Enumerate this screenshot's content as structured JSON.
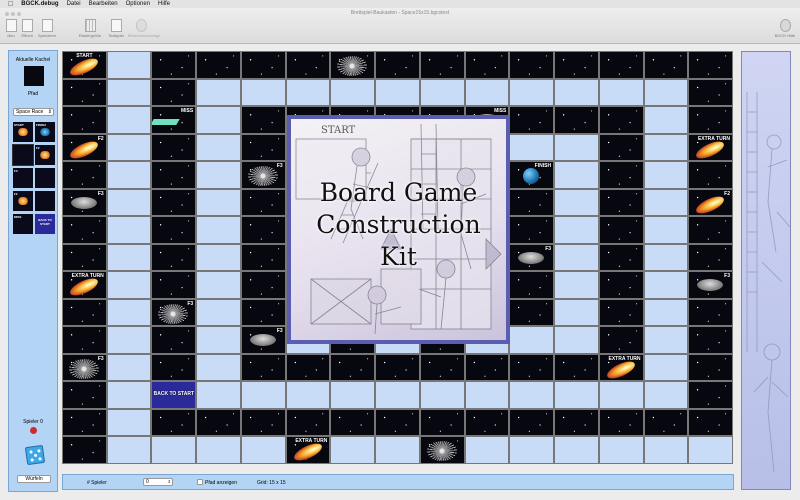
{
  "menubar": {
    "app_name": "BGCK.debug",
    "items": [
      "Datei",
      "Bearbeiten",
      "Optionen",
      "Hilfe"
    ]
  },
  "window": {
    "title": "Brettspiel-Baukasten - Space15x15.bgcstext"
  },
  "toolbar": {
    "new": "Neu",
    "open": "Öffnen",
    "save": "Speichern",
    "grid_size": "Rastergröße",
    "test_play": "Testspiel",
    "full_screen": "Bildschirmanzeige",
    "help": "BGCK Hilfe"
  },
  "sidebar": {
    "current_tile_label": "Aktuelle Kachel",
    "current_tile_name": "Pfad",
    "tileset": "Space Race",
    "palette": [
      "START",
      "FINISH",
      "F2",
      "",
      "F3",
      "F2",
      "F3",
      "",
      "",
      "",
      "MISS",
      "BACK TO START"
    ],
    "player_label": "Spieler 0",
    "roll_button": "Würfeln"
  },
  "board_tiles": {
    "start": "START",
    "miss": "MISS",
    "f2": "F2",
    "f3": "F3",
    "finish": "FINISH",
    "extra_turn": "EXTRA TURN",
    "back_to_start": "BACK TO START"
  },
  "splash": {
    "title_line1": "Board Game",
    "title_line2": "Construction",
    "title_line3": "Kit",
    "scene_sign": "START"
  },
  "statusbar": {
    "players_label": "# Spieler",
    "players_value": "0",
    "show_path_label": "Pfad anzeigen",
    "grid_label": "Grid: 15 x 15"
  },
  "colors": {
    "path": "#c8dcf8",
    "space": "#07070f",
    "panel": "#b3d4f4",
    "splash_border": "#5b5eb0"
  }
}
